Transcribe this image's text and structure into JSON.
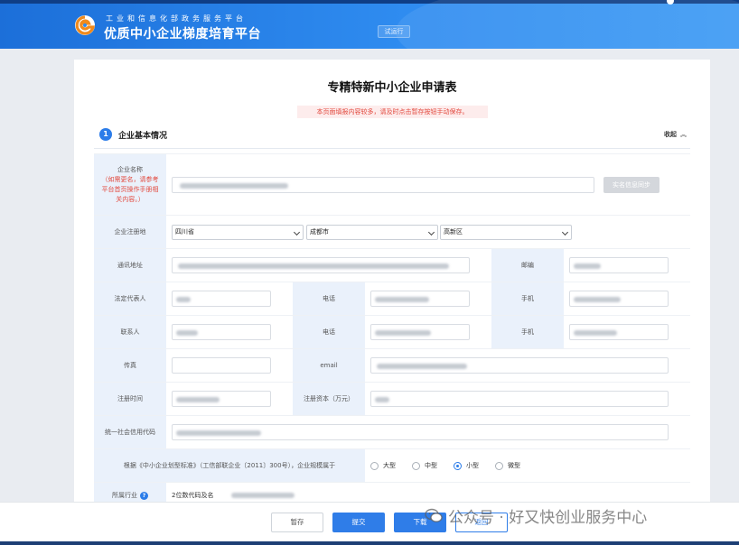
{
  "header": {
    "subtitle": "工业和信息化部政务服务平台",
    "title": "优质中小企业梯度培育平台",
    "badge": "试运行"
  },
  "form": {
    "title": "专精特新中小企业申请表",
    "notice": "本页面填报内容较多，请及时点击暂存按钮手动保存。"
  },
  "section": {
    "number": "1",
    "title": "企业基本情况",
    "collapse_label": "收起",
    "collapse_icon": "chevron-up-icon"
  },
  "fields": {
    "company_name": {
      "label": "企业名称",
      "hint": "（如需更名，请参考平台首页操作手册相关内容。）",
      "sync_button": "实名信息同步"
    },
    "reg_location": {
      "label": "企业注册地",
      "province": "四川省",
      "city": "成都市",
      "district": "高新区"
    },
    "address": {
      "label": "通讯地址"
    },
    "postcode": {
      "label": "邮编"
    },
    "legal_rep": {
      "label": "法定代表人"
    },
    "phone1": {
      "label": "电话"
    },
    "mobile1": {
      "label": "手机"
    },
    "contact": {
      "label": "联系人"
    },
    "phone2": {
      "label": "电话"
    },
    "mobile2": {
      "label": "手机"
    },
    "fax": {
      "label": "传真"
    },
    "email": {
      "label": "email"
    },
    "reg_time": {
      "label": "注册时间"
    },
    "reg_capital": {
      "label": "注册资本（万元）"
    },
    "credit_code": {
      "label": "统一社会信用代码"
    },
    "scale": {
      "label": "根据《中小企业划型标准》（工信部联企业〔2011〕300号），企业规模属于",
      "options": [
        "大型",
        "中型",
        "小型",
        "微型"
      ],
      "selected": "小型"
    },
    "industry": {
      "label": "所属行业",
      "value": "2位数代码及名"
    }
  },
  "actions": {
    "save": "暂存",
    "submit": "提交",
    "download": "下载",
    "back": "返回"
  },
  "watermark": "公众号 · 好又快创业服务中心",
  "colors": {
    "primary": "#2f7de8",
    "notice_red": "#e2483d",
    "label_bg": "#eaf1fb"
  }
}
